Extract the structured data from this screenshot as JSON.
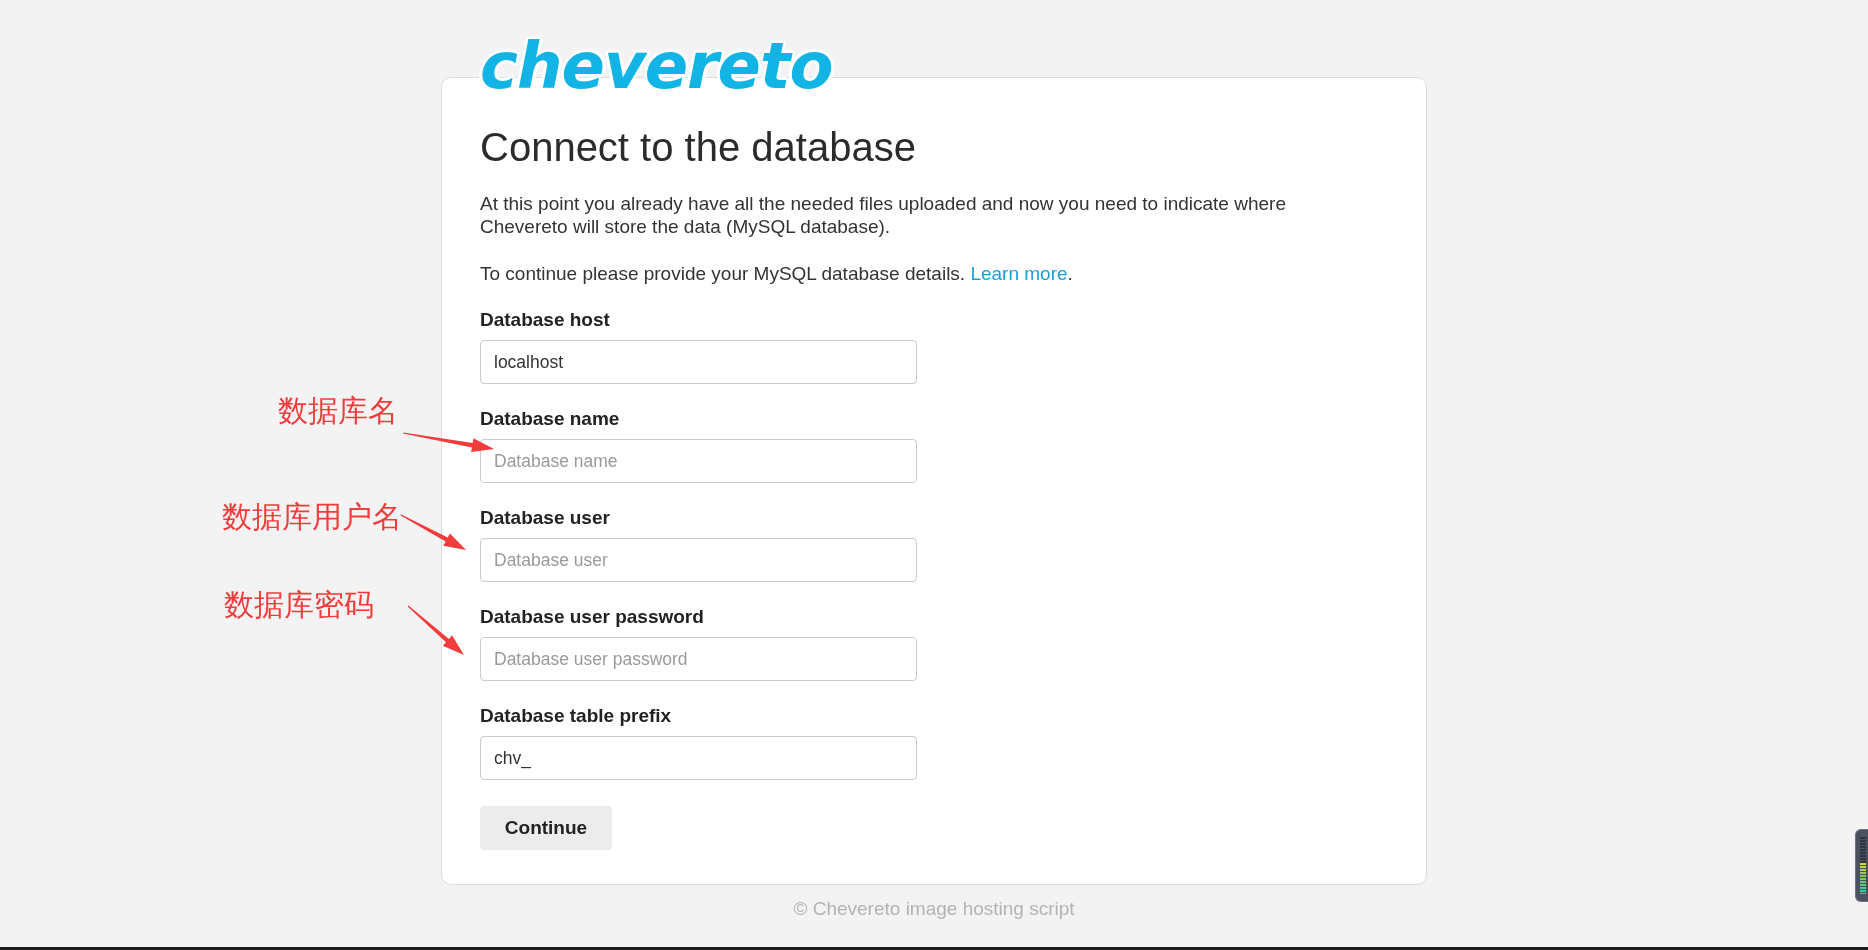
{
  "logo": {
    "text": "chevereto"
  },
  "heading": "Connect to the database",
  "intro": [
    "At this point you already have all the needed files uploaded and now you need to indicate where Chevereto will store the data (MySQL database)."
  ],
  "details": {
    "text": "To continue please provide your MySQL database details.",
    "link": "Learn more",
    "tail": "."
  },
  "fields": [
    {
      "label": "Database host",
      "value": "localhost"
    },
    {
      "label": "Database name",
      "placeholder": "Database name"
    },
    {
      "label": "Database user",
      "placeholder": "Database user"
    },
    {
      "label": "Database user password",
      "placeholder": "Database user password"
    },
    {
      "label": "Database table prefix",
      "value": "chv_"
    }
  ],
  "button": "Continue",
  "footer": "© Chevereto image hosting script",
  "annotations": [
    "数据库名",
    "数据库用户名",
    "数据库密码"
  ],
  "level_meter": {
    "level": 0.55
  }
}
